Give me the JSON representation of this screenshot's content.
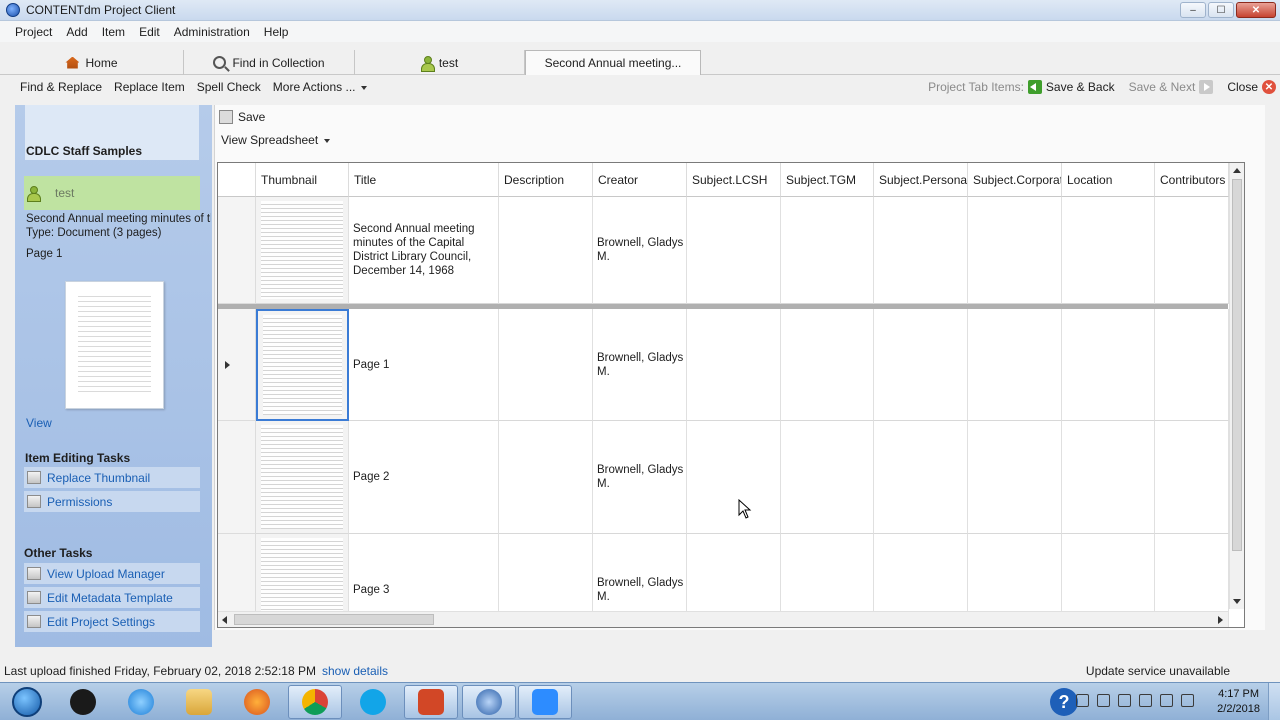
{
  "window": {
    "title": "CONTENTdm Project Client",
    "minimize": "–",
    "maximize": "☐",
    "close": "✕"
  },
  "menu": [
    "Project",
    "Add",
    "Item",
    "Edit",
    "Administration",
    "Help"
  ],
  "tabs": [
    {
      "label": "Home",
      "icon": "house-icon"
    },
    {
      "label": "Find in Collection",
      "icon": "magnifier-icon"
    },
    {
      "label": "test",
      "icon": "user-icon"
    },
    {
      "label": "Second Annual meeting...",
      "icon": ""
    }
  ],
  "toolbar": {
    "find_replace": "Find & Replace",
    "replace_item": "Replace Item",
    "spell_check": "Spell Check",
    "more_actions": "More Actions ...",
    "project_tab_items": "Project Tab Items:",
    "save_back": "Save & Back",
    "save_next": "Save & Next",
    "close": "Close"
  },
  "sidebar": {
    "collection": "CDLC Staff Samples",
    "project": "test",
    "item_title": "Second Annual meeting minutes of th",
    "item_type": "Type: Document (3 pages)",
    "page": "Page 1",
    "view_link": "View",
    "item_editing_tasks": "Item Editing Tasks",
    "replace_thumbnail": "Replace Thumbnail",
    "permissions": "Permissions",
    "other_tasks": "Other Tasks",
    "view_upload_manager": "View Upload Manager",
    "edit_metadata_template": "Edit Metadata Template",
    "edit_project_settings": "Edit Project Settings"
  },
  "main": {
    "save": "Save",
    "view_spreadsheet": "View Spreadsheet",
    "columns": [
      "Thumbnail",
      "Title",
      "Description",
      "Creator",
      "Subject.LCSH",
      "Subject.TGM",
      "Subject.Personal_",
      "Subject.Corporatе",
      "Location",
      "Contributors"
    ],
    "rows": [
      {
        "title_lines": [
          "Second Annual meeting",
          "minutes of the Capital",
          "District Library Council,",
          "December 14, 1968"
        ],
        "creator_lines": [
          "Brownell, Gladys",
          "M."
        ]
      },
      {
        "title_lines": [
          "Page 1"
        ],
        "creator_lines": [
          "Brownell, Gladys",
          "M."
        ]
      },
      {
        "title_lines": [
          "Page 2"
        ],
        "creator_lines": [
          "Brownell, Gladys",
          "M."
        ]
      },
      {
        "title_lines": [
          "Page 3"
        ],
        "creator_lines": [
          "Brownell, Gladys",
          "M."
        ]
      }
    ]
  },
  "status": {
    "last_upload": "Last upload finished Friday, February 02, 2018 2:52:18 PM",
    "show_details": "show details",
    "update_service": "Update service unavailable"
  },
  "taskbar": {
    "time": "4:17 PM",
    "date": "2/2/2018",
    "help": "?"
  }
}
